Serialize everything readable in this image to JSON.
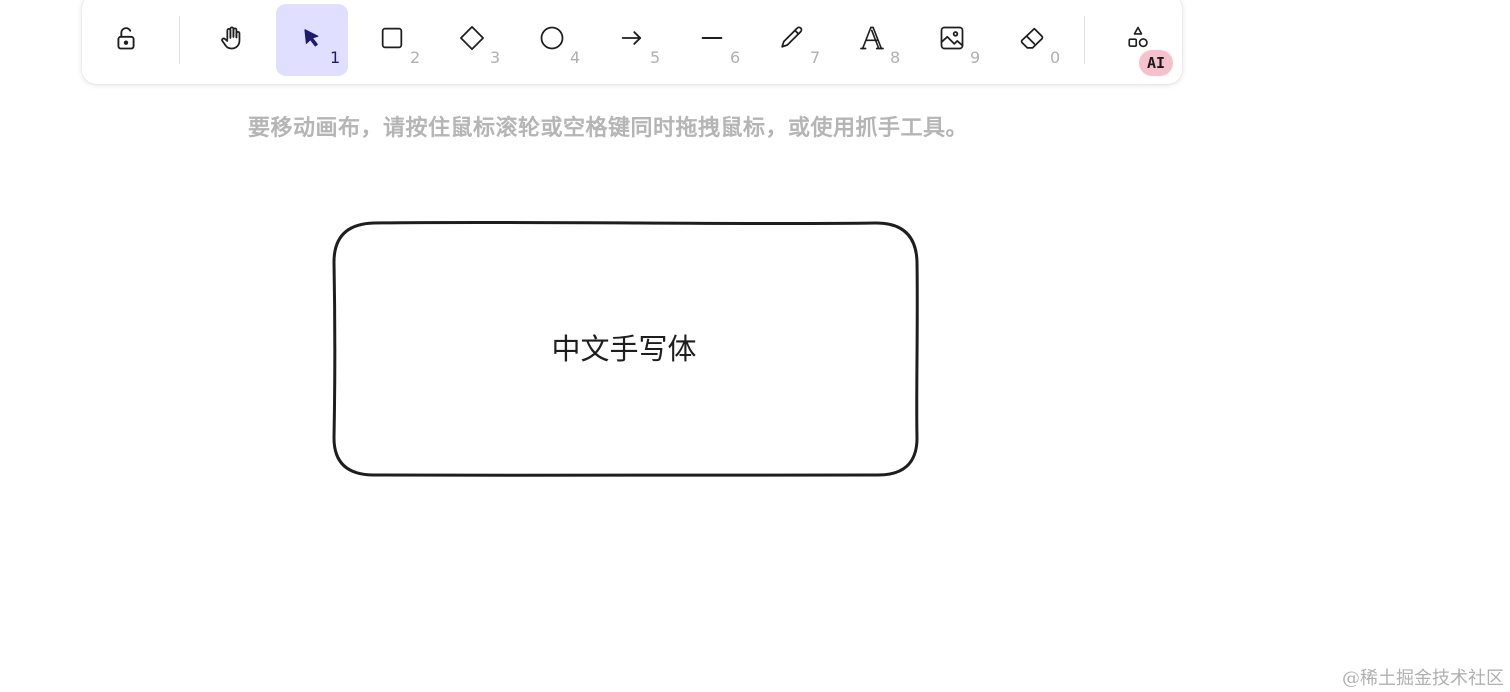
{
  "toolbar": {
    "tools": [
      {
        "name": "lock",
        "icon": "lock-open-icon",
        "key": ""
      },
      {
        "name": "hand",
        "icon": "hand-icon",
        "key": ""
      },
      {
        "name": "selection",
        "icon": "pointer-icon",
        "key": "1",
        "active": true
      },
      {
        "name": "rectangle",
        "icon": "square-icon",
        "key": "2"
      },
      {
        "name": "diamond",
        "icon": "diamond-icon",
        "key": "3"
      },
      {
        "name": "ellipse",
        "icon": "circle-icon",
        "key": "4"
      },
      {
        "name": "arrow",
        "icon": "arrow-right-icon",
        "key": "5"
      },
      {
        "name": "line",
        "icon": "line-icon",
        "key": "6"
      },
      {
        "name": "draw",
        "icon": "pencil-icon",
        "key": "7"
      },
      {
        "name": "text",
        "icon": "text-icon",
        "key": "8"
      },
      {
        "name": "image",
        "icon": "image-icon",
        "key": "9"
      },
      {
        "name": "eraser",
        "icon": "eraser-icon",
        "key": "0"
      },
      {
        "name": "shapes",
        "icon": "shapes-icon",
        "key": ""
      }
    ],
    "ai_badge": "AI",
    "active_color": "#e0dfff",
    "active_icon_color": "#1e1b6b"
  },
  "canvas": {
    "hint": "要移动画布，请按住鼠标滚轮或空格键同时拖拽鼠标，或使用抓手工具。",
    "shape": {
      "type": "rounded-rectangle",
      "label": "中文手写体",
      "stroke": "#1e1e1e"
    }
  },
  "watermark": "@稀土掘金技术社区"
}
